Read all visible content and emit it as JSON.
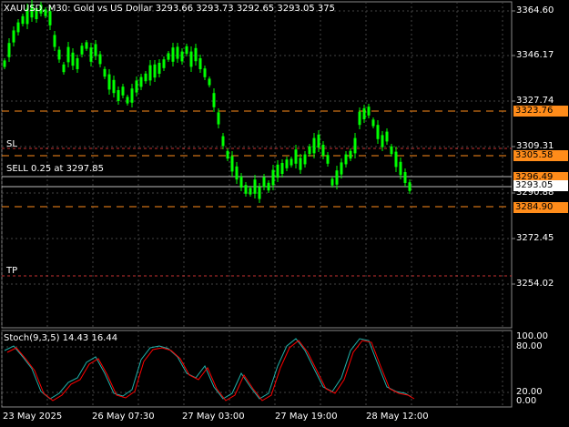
{
  "header": {
    "text": "XAUUSD, M30:  Gold vs US Dollar  3293.66 3293.73 3292.65 3293.05  375"
  },
  "order_lines": {
    "sl_label": "SL",
    "sell_label": "SELL 0.25 at 3297.85",
    "tp_label": "TP"
  },
  "price_axis": {
    "ticks": [
      "3364.60",
      "3346.17",
      "3327.74",
      "3309.31",
      "3290.88",
      "3272.45",
      "3254.02"
    ],
    "boxes": [
      "3323.76",
      "3305.58",
      "3296.49",
      "3284.90"
    ],
    "current": "3293.05"
  },
  "stoch": {
    "label": "Stoch(9,3,5) 14.43 16.44",
    "ticks": [
      "100.00",
      "80.00",
      "20.00",
      "0.00"
    ]
  },
  "time_axis": {
    "labels": [
      "23 May 2025",
      "26 May 07:30",
      "27 May 03:00",
      "27 May 19:00",
      "28 May 12:00"
    ]
  },
  "colors": {
    "bull": "#00ff00",
    "bear": "#00ff00",
    "grid": "#444",
    "level": "#ff8c1a",
    "sl_line": "#c83232",
    "stoch_main": "#20b2aa",
    "stoch_signal": "#ff0000",
    "axis_bg": "#000"
  }
}
